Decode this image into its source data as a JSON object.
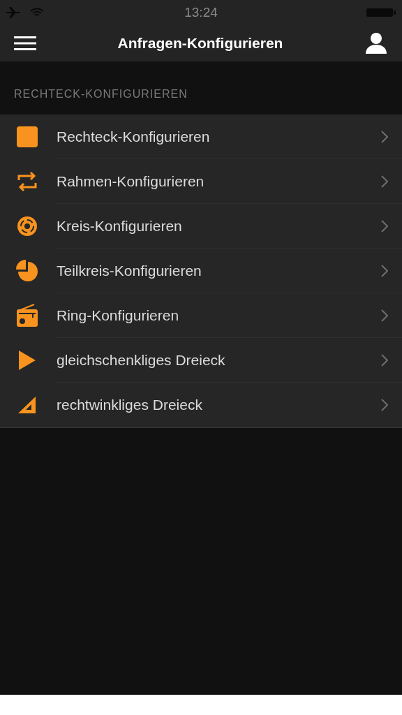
{
  "status_bar": {
    "time": "13:24"
  },
  "nav_bar": {
    "title": "Anfragen-Konfigurieren"
  },
  "section": {
    "header": "RECHTECK-KONFIGURIEREN",
    "items": [
      {
        "kind": "square",
        "label": "Rechteck-Konfigurieren"
      },
      {
        "kind": "repeat",
        "label": "Rahmen-Konfigurieren"
      },
      {
        "kind": "lifebuoy",
        "label": "Kreis-Konfigurieren"
      },
      {
        "kind": "pie",
        "label": "Teilkreis-Konfigurieren"
      },
      {
        "kind": "radio",
        "label": "Ring-Konfigurieren"
      },
      {
        "kind": "play",
        "label": "gleichschenkliges Dreieck"
      },
      {
        "kind": "set-square",
        "label": "rechtwinkliges Dreieck"
      }
    ]
  }
}
